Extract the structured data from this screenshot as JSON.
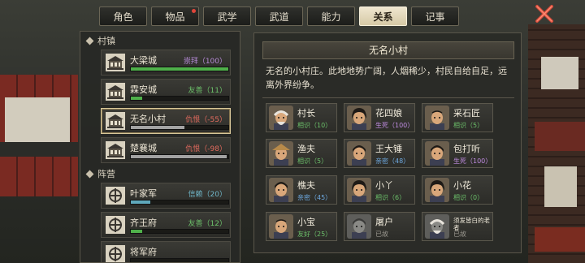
{
  "tabs": [
    {
      "label": "角色",
      "active": false,
      "badge": false
    },
    {
      "label": "物品",
      "active": false,
      "badge": true
    },
    {
      "label": "武学",
      "active": false,
      "badge": false
    },
    {
      "label": "武道",
      "active": false,
      "badge": false
    },
    {
      "label": "能力",
      "active": false,
      "badge": false
    },
    {
      "label": "关系",
      "active": true,
      "badge": false
    },
    {
      "label": "记事",
      "active": false,
      "badge": false
    }
  ],
  "close_icon": "close-x-icon",
  "sections": {
    "towns": {
      "title": "村镇",
      "entries": [
        {
          "name": "大梁城",
          "relation": "崇拜（100）",
          "rel_color": "purple",
          "fill_pct": 100,
          "fill_color": "green",
          "selected": false
        },
        {
          "name": "霖安城",
          "relation": "友善（11）",
          "rel_color": "green",
          "fill_pct": 12,
          "fill_color": "green",
          "selected": false
        },
        {
          "name": "无名小村",
          "relation": "仇恨（-55）",
          "rel_color": "red",
          "fill_pct": 55,
          "fill_color": "gray",
          "selected": true
        },
        {
          "name": "楚襄城",
          "relation": "仇恨（-98）",
          "rel_color": "red",
          "fill_pct": 98,
          "fill_color": "gray",
          "selected": false
        }
      ]
    },
    "factions": {
      "title": "阵营",
      "entries": [
        {
          "name": "叶家军",
          "relation": "信赖（20）",
          "rel_color": "teal",
          "fill_pct": 20,
          "fill_color": "teal",
          "selected": false
        },
        {
          "name": "齐王府",
          "relation": "友善（12）",
          "rel_color": "green",
          "fill_pct": 12,
          "fill_color": "green",
          "selected": false
        },
        {
          "name": "将军府",
          "relation": "",
          "rel_color": "green",
          "fill_pct": 0,
          "fill_color": "green",
          "selected": false
        }
      ]
    }
  },
  "detail": {
    "title": "无名小村",
    "description": "无名的小村庄。此地地势广阔，人烟稀少，村民自给自足，远离外界纷争。",
    "npcs": [
      {
        "name": "村长",
        "status": "相识（10）",
        "status_color": "green",
        "face": "elder"
      },
      {
        "name": "花四娘",
        "status": "生死（100）",
        "status_color": "purple",
        "face": "woman"
      },
      {
        "name": "采石匠",
        "status": "相识（5）",
        "status_color": "green",
        "face": "bald"
      },
      {
        "name": "渔夫",
        "status": "相识（5）",
        "status_color": "green",
        "face": "hat"
      },
      {
        "name": "王大锤",
        "status": "亲密（48）",
        "status_color": "blue",
        "face": "man"
      },
      {
        "name": "包打听",
        "status": "生死（100）",
        "status_color": "purple",
        "face": "man2"
      },
      {
        "name": "樵夫",
        "status": "亲密（45）",
        "status_color": "blue",
        "face": "man"
      },
      {
        "name": "小丫",
        "status": "相识（6）",
        "status_color": "green",
        "face": "girl"
      },
      {
        "name": "小花",
        "status": "相识（0）",
        "status_color": "green",
        "face": "girl2"
      },
      {
        "name": "小宝",
        "status": "友好（25）",
        "status_color": "green",
        "face": "child"
      },
      {
        "name": "屠户",
        "status": "已故",
        "status_color": "gray",
        "face": "dead"
      },
      {
        "name": "须发皆白的老者",
        "status": "已故",
        "status_color": "gray",
        "face": "dead2"
      }
    ]
  }
}
